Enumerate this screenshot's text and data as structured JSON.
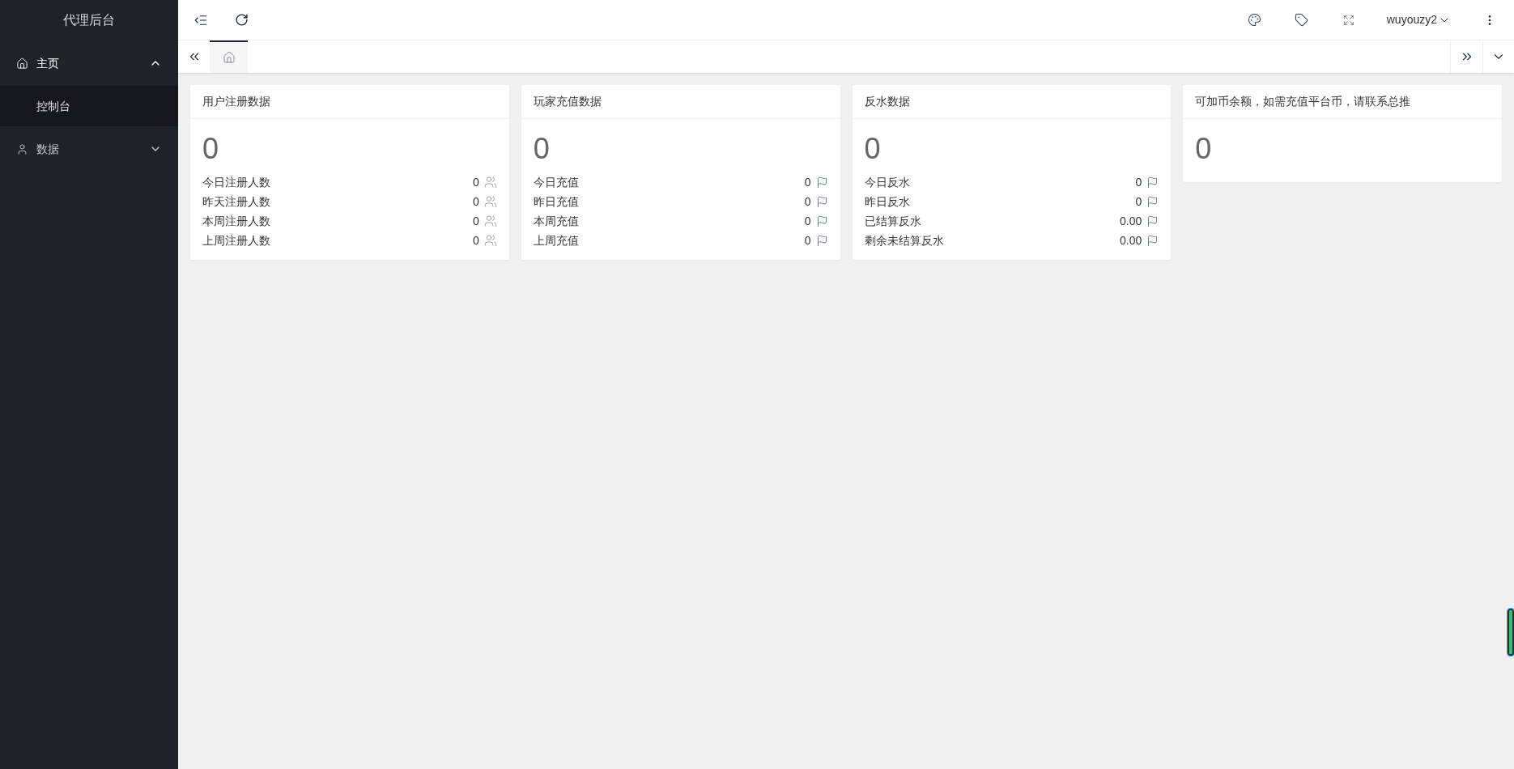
{
  "sidebar": {
    "title": "代理后台",
    "items": [
      {
        "label": "主页",
        "kind": "home",
        "expanded": true,
        "children": [
          {
            "label": "控制台",
            "selected": true
          }
        ]
      },
      {
        "label": "数据",
        "kind": "user",
        "expanded": false
      }
    ]
  },
  "header": {
    "user": "wuyouzy2"
  },
  "tabs": [
    {
      "kind": "home",
      "selected": true
    }
  ],
  "cards": [
    {
      "title": "用户注册数据",
      "total": "0",
      "rows": [
        {
          "label": "今日注册人数",
          "value": "0",
          "kind": "user"
        },
        {
          "label": "昨天注册人数",
          "value": "0",
          "kind": "user"
        },
        {
          "label": "本周注册人数",
          "value": "0",
          "kind": "user"
        },
        {
          "label": "上周注册人数",
          "value": "0",
          "kind": "user"
        }
      ]
    },
    {
      "title": "玩家充值数据",
      "total": "0",
      "rows": [
        {
          "label": "今日充值",
          "value": "0",
          "kind": "flag"
        },
        {
          "label": "昨日充值",
          "value": "0",
          "kind": "flag"
        },
        {
          "label": "本周充值",
          "value": "0",
          "kind": "flag"
        },
        {
          "label": "上周充值",
          "value": "0",
          "kind": "flag"
        }
      ]
    },
    {
      "title": "反水数据",
      "total": "0",
      "rows": [
        {
          "label": "今日反水",
          "value": "0",
          "kind": "flag"
        },
        {
          "label": "昨日反水",
          "value": "0",
          "kind": "flag"
        },
        {
          "label": "已结算反水",
          "value": "0.00",
          "kind": "flag"
        },
        {
          "label": "剩余未结算反水",
          "value": "0.00",
          "kind": "flag"
        }
      ]
    },
    {
      "title": "可加币余额，如需充值平台币，请联系总推",
      "total": "0"
    }
  ]
}
